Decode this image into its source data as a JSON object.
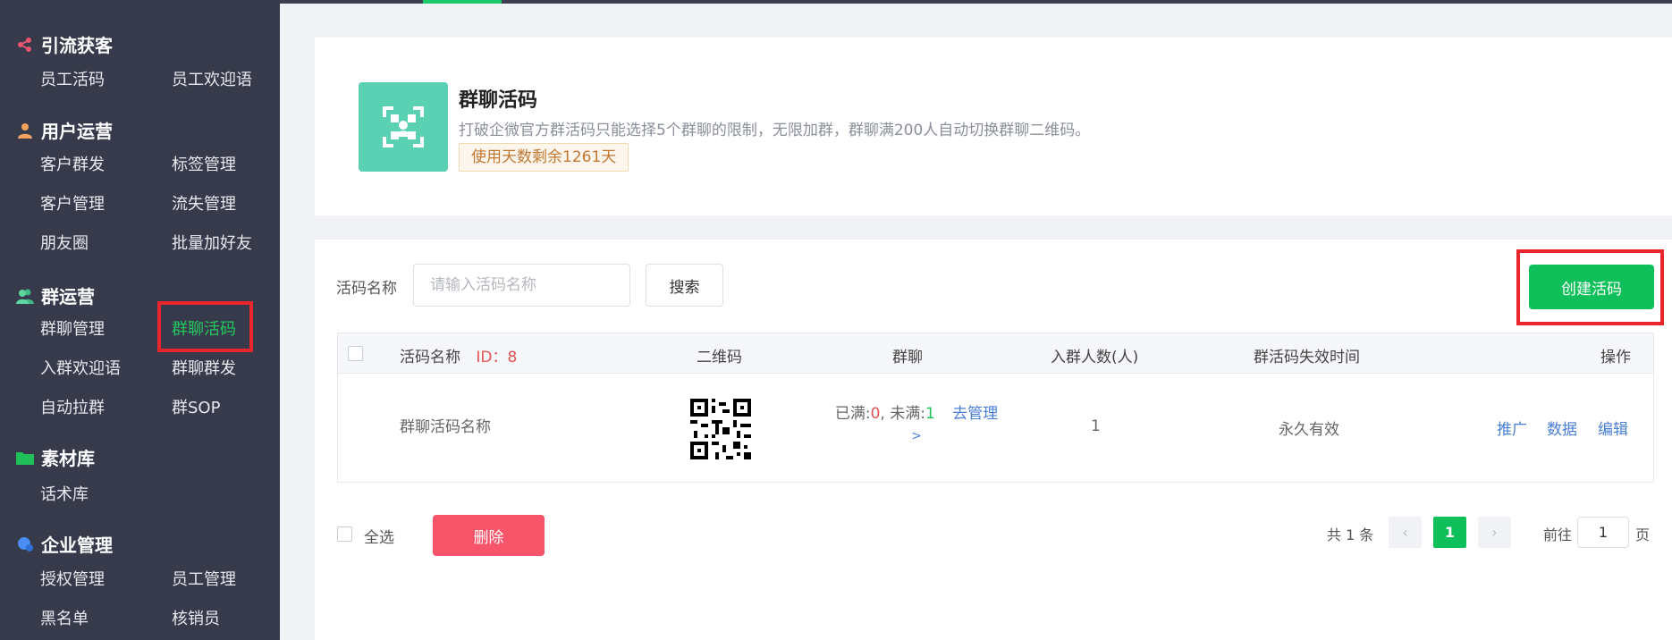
{
  "sidebar": {
    "sections": [
      {
        "title": "引流获客",
        "items": [
          "员工活码",
          "员工欢迎语"
        ]
      },
      {
        "title": "用户运营",
        "items": [
          "客户群发",
          "标签管理",
          "客户管理",
          "流失管理",
          "朋友圈",
          "批量加好友"
        ]
      },
      {
        "title": "群运营",
        "items": [
          "群聊管理",
          "群聊活码",
          "入群欢迎语",
          "群聊群发",
          "自动拉群",
          "群SOP"
        ]
      },
      {
        "title": "素材库",
        "items": [
          "话术库"
        ]
      },
      {
        "title": "企业管理",
        "items": [
          "授权管理",
          "员工管理",
          "黑名单",
          "核销员"
        ]
      }
    ],
    "active_item": "群聊活码"
  },
  "banner": {
    "title": "群聊活码",
    "description": "打破企微官方群活码只能选择5个群聊的限制，无限加群，群聊满200人自动切换群聊二维码。",
    "days_tag": "使用天数剩余1261天"
  },
  "filter": {
    "label": "活码名称",
    "placeholder": "请输入活码名称",
    "search_button": "搜索",
    "create_button": "创建活码"
  },
  "table": {
    "columns": [
      "活码名称",
      "二维码",
      "群聊",
      "入群人数(人)",
      "群活码失效时间",
      "操作"
    ],
    "id_label": "ID：8",
    "rows": [
      {
        "name": "群聊活码名称",
        "full_label": "已满:",
        "full_count": "0",
        "not_full_label": ", 未满:",
        "not_full_count": "1",
        "manage_link": "去管理",
        "manage_arrow": ">",
        "members": "1",
        "expiry": "永久有效",
        "actions": [
          "推广",
          "数据",
          "编辑"
        ]
      }
    ]
  },
  "footer": {
    "select_all": "全选",
    "delete_button": "删除",
    "total": "共 1 条",
    "current_page": "1",
    "goto_label": "前往",
    "goto_value": "1",
    "page_suffix": "页"
  },
  "colors": {
    "accent": "#0fc05a",
    "danger": "#f55469",
    "link": "#4a7fd8",
    "highlight": "#e8262c",
    "sidebar_bg": "#363a4b",
    "qr_tile": "#59d1b2"
  }
}
